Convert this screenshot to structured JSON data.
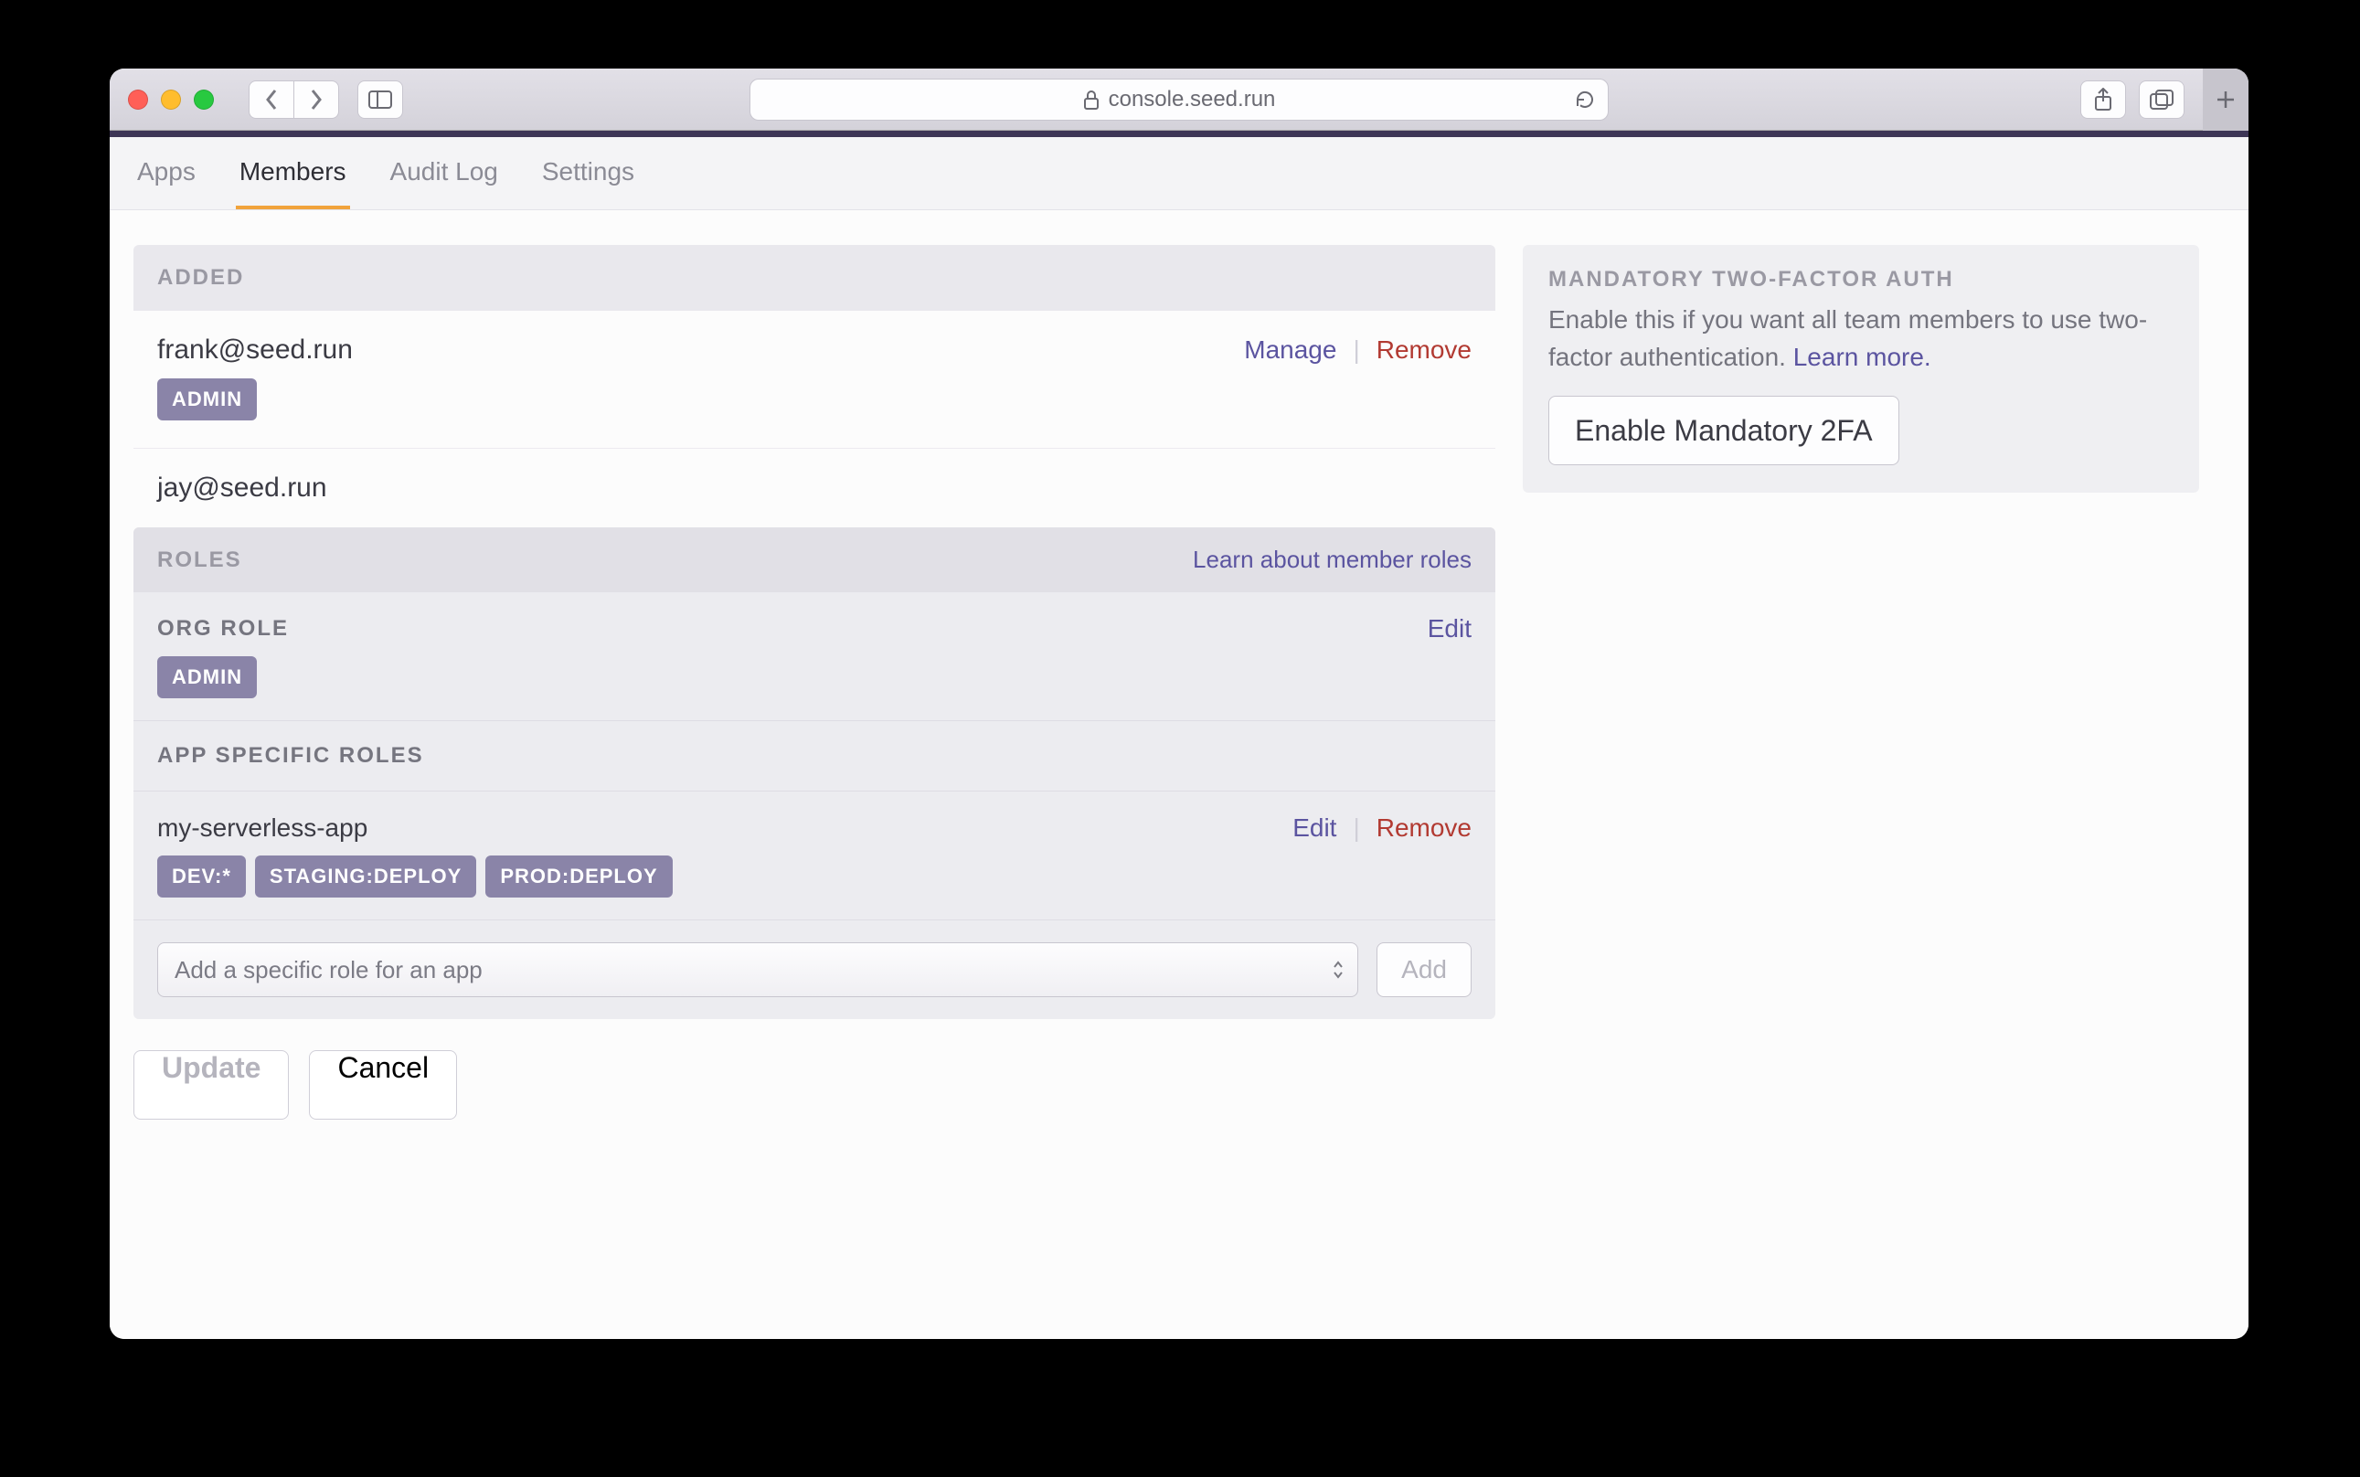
{
  "browser": {
    "url": "console.seed.run"
  },
  "tabs": {
    "items": [
      "Apps",
      "Members",
      "Audit Log",
      "Settings"
    ],
    "active": 1
  },
  "added": {
    "header": "ADDED",
    "members": [
      {
        "email": "frank@seed.run",
        "badges": [
          "ADMIN"
        ],
        "actions": {
          "manage": "Manage",
          "remove": "Remove"
        }
      }
    ]
  },
  "editing": {
    "email": "jay@seed.run",
    "roles_header": "ROLES",
    "roles_learn": "Learn about member roles",
    "org_role": {
      "title": "ORG ROLE",
      "badges": [
        "ADMIN"
      ],
      "edit": "Edit"
    },
    "app_roles": {
      "title": "APP SPECIFIC ROLES",
      "apps": [
        {
          "name": "my-serverless-app",
          "badges": [
            "DEV:*",
            "STAGING:DEPLOY",
            "PROD:DEPLOY"
          ],
          "actions": {
            "edit": "Edit",
            "remove": "Remove"
          }
        }
      ]
    },
    "add_role": {
      "placeholder": "Add a specific role for an app",
      "button": "Add"
    },
    "update": "Update",
    "cancel": "Cancel"
  },
  "twofa": {
    "title": "MANDATORY TWO-FACTOR AUTH",
    "text": "Enable this if you want all team members to use two-factor authentication. ",
    "learn": "Learn more.",
    "button": "Enable Mandatory 2FA"
  }
}
